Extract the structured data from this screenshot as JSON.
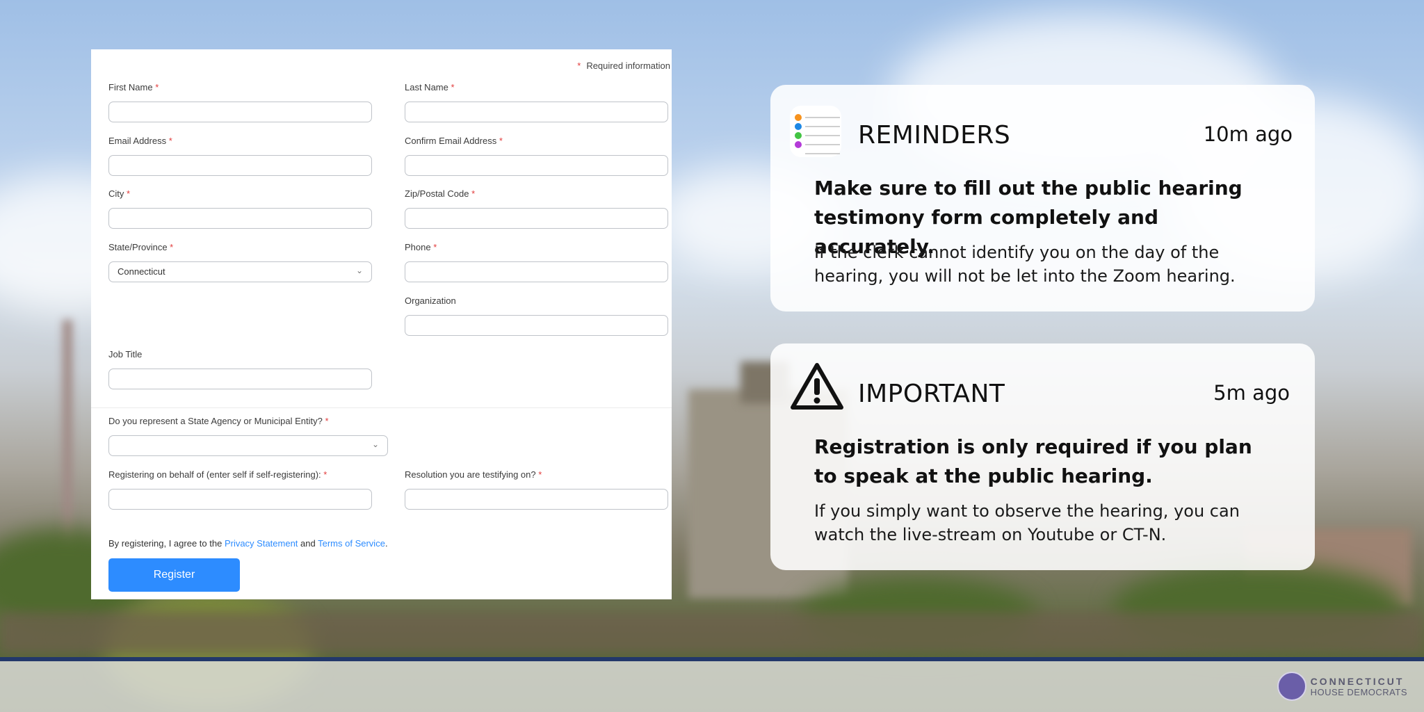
{
  "form": {
    "required_note": "Required information",
    "fields": {
      "first_name": "First Name",
      "last_name": "Last Name",
      "email": "Email Address",
      "confirm_email": "Confirm Email Address",
      "city": "City",
      "zip": "Zip/Postal Code",
      "state": "State/Province",
      "state_value": "Connecticut",
      "phone": "Phone",
      "organization": "Organization",
      "job_title": "Job Title",
      "agency_question": "Do you represent a State Agency or Municipal Entity?",
      "behalf": "Registering on behalf of (enter self if self-registering):",
      "resolution": "Resolution you are testifying on?"
    },
    "agree_prefix": "By registering, I agree to the ",
    "privacy_link": "Privacy Statement",
    "and_text": " and ",
    "terms_link": "Terms of Service",
    "period": ".",
    "register_button": "Register",
    "required_marker": "*"
  },
  "notifications": [
    {
      "app": "REMINDERS",
      "time": "10m ago",
      "headline": "Make sure to fill out the public hearing testimony form completely and accurately.",
      "body": "If the clerk cannot identify you on the day of the hearing, you will not be let into the Zoom hearing.",
      "icon": "reminders-list-icon"
    },
    {
      "app": "IMPORTANT",
      "time": "5m ago",
      "headline": "Registration is only required if you plan to speak at the public hearing.",
      "body": "If you simply want to observe the hearing, you can watch the live-stream on Youtube or CT-N.",
      "icon": "warning-triangle-icon"
    }
  ],
  "logo": {
    "line1": "CONNECTICUT",
    "line2": "HOUSE DEMOCRATS"
  },
  "colors": {
    "accent": "#2d8cff",
    "required": "#e23c3c",
    "footer_bar": "#22386a"
  }
}
